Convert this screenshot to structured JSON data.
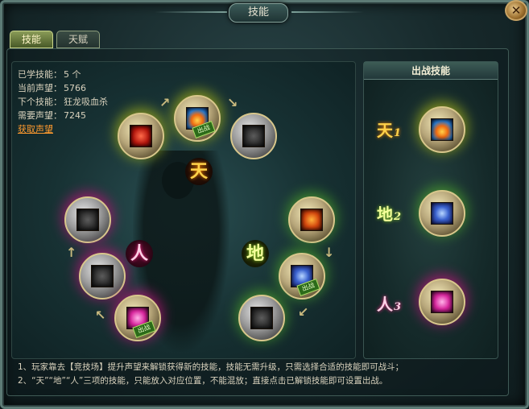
{
  "window": {
    "title": "技能",
    "close_label": "✕"
  },
  "tabs": [
    {
      "label": "技能",
      "active": true
    },
    {
      "label": "天赋",
      "active": false
    }
  ],
  "stats": {
    "learned_label": "已学技能：",
    "learned_value": "5 个",
    "prestige_label": "当前声望：",
    "prestige_value": "5766",
    "next_skill_label": "下个技能：",
    "next_skill_value": "狂龙吸血杀",
    "required_label": "需要声望：",
    "required_value": "7245",
    "get_prestige_link": "获取声望"
  },
  "categories": {
    "heaven": "天",
    "earth": "地",
    "human": "人"
  },
  "badges": {
    "deployed": "出战"
  },
  "skill_tree": {
    "heaven_nodes": [
      {
        "icon": "blood-red-skill-icon",
        "unlocked": true,
        "deployed": false
      },
      {
        "icon": "fire-vortex-skill-icon",
        "unlocked": true,
        "deployed": true
      },
      {
        "icon": "locked-skill-icon",
        "unlocked": false,
        "deployed": false
      }
    ],
    "earth_nodes": [
      {
        "icon": "flame-body-skill-icon",
        "unlocked": true,
        "deployed": false
      },
      {
        "icon": "taiji-skill-icon",
        "unlocked": true,
        "deployed": true
      },
      {
        "icon": "locked-skill-icon",
        "unlocked": false,
        "deployed": false
      }
    ],
    "human_nodes": [
      {
        "icon": "locked-skill-icon",
        "unlocked": false,
        "deployed": false
      },
      {
        "icon": "locked-skill-icon",
        "unlocked": false,
        "deployed": false
      },
      {
        "icon": "heart-skill-icon",
        "unlocked": true,
        "deployed": true
      }
    ]
  },
  "battle_panel": {
    "title": "出战技能",
    "slots": [
      {
        "char": "天",
        "num": "1"
      },
      {
        "char": "地",
        "num": "2"
      },
      {
        "char": "人",
        "num": "3"
      }
    ]
  },
  "notes": {
    "line1": "1、玩家靠去【竞技场】提升声望来解锁获得新的技能，技能无需升级，只需选择合适的技能即可战斗；",
    "line2": "2、“天”“地”“人”三项的技能，只能放入对应位置，不能混放；直接点击已解锁技能即可设置出战。"
  }
}
